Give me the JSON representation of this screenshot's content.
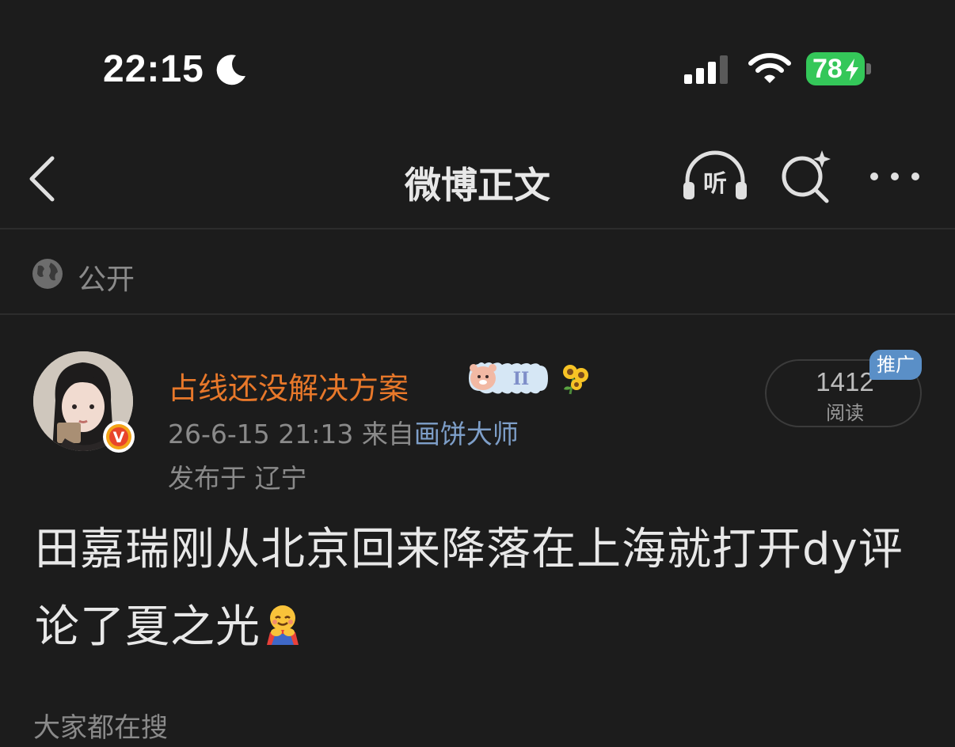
{
  "status_bar": {
    "time": "22:15",
    "battery": "78"
  },
  "nav": {
    "title": "微博正文"
  },
  "visibility": {
    "label": "公开"
  },
  "author": {
    "name": "占线还没解决方案",
    "badge_letter": "V"
  },
  "meta": {
    "datetime": "26-6-15 21:13",
    "source_prefix": "来自",
    "source": "画饼大师",
    "location": "发布于 辽宁"
  },
  "read": {
    "count": "1412",
    "label": "阅读",
    "ad_tag": "推广"
  },
  "post": {
    "text": "田嘉瑞刚从北京回来降落在上海就打开dy评论了夏之光"
  },
  "section": {
    "label": "大家都在搜"
  },
  "colors": {
    "background": "#1c1c1c",
    "author_name": "#e8782a",
    "link": "#7e9fc9",
    "ad_tag": "#5a8fc7",
    "battery": "#34c759",
    "verified": "#f3a417"
  },
  "icons": [
    "moon-icon",
    "signal-icon",
    "wifi-icon",
    "bolt-icon",
    "back-icon",
    "listen-icon",
    "search-icon",
    "more-icon",
    "globe-icon",
    "verified-icon",
    "sunflower-icon",
    "hug-emoji"
  ]
}
